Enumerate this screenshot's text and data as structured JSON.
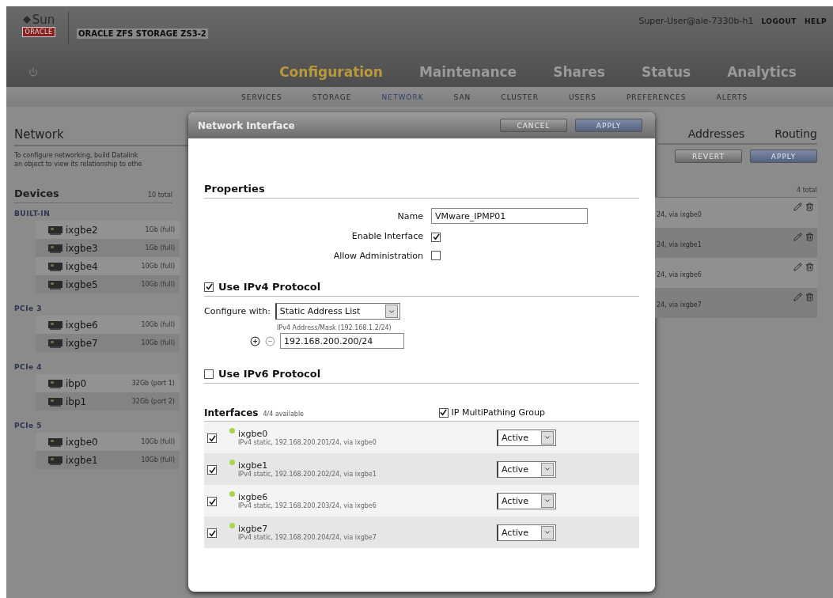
{
  "header": {
    "logo_top": "Sun",
    "logo_bottom": "ORACLE",
    "product": "ORACLE ZFS STORAGE ZS3-2",
    "user": "Super-User@aie-7330b-h1",
    "links": [
      "LOGOUT",
      "HELP"
    ],
    "main_tabs": [
      {
        "label": "Configuration",
        "selected": true
      },
      {
        "label": "Maintenance",
        "selected": false
      },
      {
        "label": "Shares",
        "selected": false
      },
      {
        "label": "Status",
        "selected": false
      },
      {
        "label": "Analytics",
        "selected": false
      }
    ],
    "sub_tabs": [
      {
        "label": "SERVICES",
        "selected": false
      },
      {
        "label": "STORAGE",
        "selected": false
      },
      {
        "label": "NETWORK",
        "selected": true
      },
      {
        "label": "SAN",
        "selected": false
      },
      {
        "label": "CLUSTER",
        "selected": false
      },
      {
        "label": "USERS",
        "selected": false
      },
      {
        "label": "PREFERENCES",
        "selected": false
      },
      {
        "label": "ALERTS",
        "selected": false
      }
    ]
  },
  "left": {
    "title": "Network",
    "description": [
      "To configure networking, build Datalink",
      "an object to view its relationship to othe"
    ],
    "devices_title": "Devices",
    "devices_count": "10 total",
    "groups": [
      {
        "label": "BUILT-IN",
        "devices": [
          {
            "name": "ixgbe2",
            "speed": "1Gb (full)"
          },
          {
            "name": "ixgbe3",
            "speed": "1Gb (full)"
          },
          {
            "name": "ixgbe4",
            "speed": "10Gb (full)"
          },
          {
            "name": "ixgbe5",
            "speed": "10Gb (full)"
          }
        ]
      },
      {
        "label": "PCIe 3",
        "devices": [
          {
            "name": "ixgbe6",
            "speed": "10Gb (full)"
          },
          {
            "name": "ixgbe7",
            "speed": "10Gb (full)"
          }
        ]
      },
      {
        "label": "PCIe 4",
        "devices": [
          {
            "name": "ibp0",
            "speed": "32Gb (port 1)"
          },
          {
            "name": "ibp1",
            "speed": "32Gb (port 2)"
          }
        ]
      },
      {
        "label": "PCIe 5",
        "devices": [
          {
            "name": "ixgbe0",
            "speed": "10Gb (full)"
          },
          {
            "name": "ixgbe1",
            "speed": "10Gb (full)"
          }
        ]
      }
    ]
  },
  "right": {
    "tabs": [
      "Addresses",
      "Routing"
    ],
    "buttons": [
      {
        "label": "REVERT",
        "kind": "secondary"
      },
      {
        "label": "APPLY",
        "kind": "primary"
      }
    ],
    "count": "4 total",
    "rows": [
      "24, via ixgbe0",
      "24, via ixgbe1",
      "24, via ixgbe6",
      "24, via ixgbe7"
    ]
  },
  "dialog": {
    "title": "Network Interface",
    "buttons": [
      {
        "label": "CANCEL",
        "kind": "secondary"
      },
      {
        "label": "APPLY",
        "kind": "primary"
      }
    ],
    "properties_title": "Properties",
    "name_label": "Name",
    "name_value": "VMware_IPMP01",
    "options": [
      {
        "label": "Enable Interface",
        "checked": true
      },
      {
        "label": "Allow Administration",
        "checked": false
      }
    ],
    "ipv4": {
      "label": "Use IPv4 Protocol",
      "checked": true
    },
    "configure_label": "Configure with:",
    "configure_value": "Static Address List",
    "address_hint": "IPv4 Address/Mask (192.168.1.2/24)",
    "address_value": "192.168.200.200/24",
    "ipv6": {
      "label": "Use IPv6 Protocol",
      "checked": false
    },
    "interfaces_title": "Interfaces",
    "interfaces_count": "4/4 available",
    "ipmp": {
      "label": "IP MultiPathing Group",
      "checked": true
    },
    "interfaces": [
      {
        "name": "ixgbe0",
        "detail": "IPv4 static, 192.168.200.201/24, via ixgbe0",
        "checked": true,
        "mode": "Active"
      },
      {
        "name": "ixgbe1",
        "detail": "IPv4 static, 192.168.200.202/24, via ixgbe1",
        "checked": true,
        "mode": "Active"
      },
      {
        "name": "ixgbe6",
        "detail": "IPv4 static, 192.168.200.203/24, via ixgbe6",
        "checked": true,
        "mode": "Active"
      },
      {
        "name": "ixgbe7",
        "detail": "IPv4 static, 192.168.200.204/24, via ixgbe7",
        "checked": true,
        "mode": "Active"
      }
    ]
  }
}
